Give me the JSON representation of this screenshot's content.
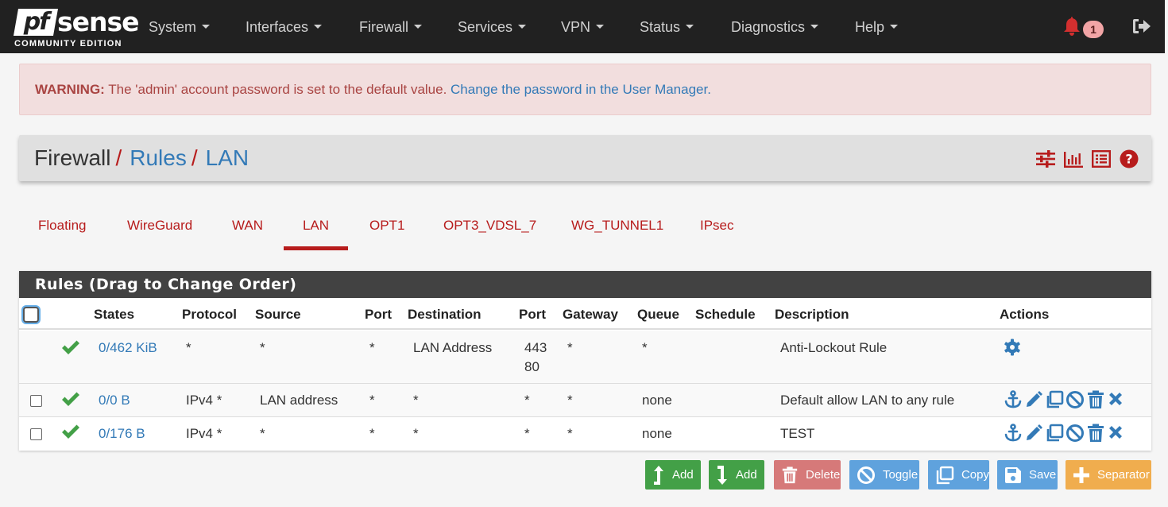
{
  "navbar": {
    "logo_pf": "pf",
    "logo_sense": "sense",
    "logo_edition": "COMMUNITY EDITION",
    "menu": [
      {
        "label": "System"
      },
      {
        "label": "Interfaces"
      },
      {
        "label": "Firewall"
      },
      {
        "label": "Services"
      },
      {
        "label": "VPN"
      },
      {
        "label": "Status"
      },
      {
        "label": "Diagnostics"
      },
      {
        "label": "Help"
      }
    ],
    "notification_count": "1",
    "icons": {
      "notifications": "bell-icon",
      "logout": "sign-out-icon"
    }
  },
  "alert": {
    "prefix": "WARNING:",
    "message": " The 'admin' account password is set to the default value. ",
    "link": "Change the password in the User Manager."
  },
  "breadcrumb": {
    "items": [
      "Firewall",
      "Rules",
      "LAN"
    ],
    "separator": "/",
    "icons": [
      "sliders-icon",
      "bar-chart-icon",
      "list-icon",
      "help-icon"
    ]
  },
  "tabs": [
    {
      "label": "Floating"
    },
    {
      "label": "WireGuard"
    },
    {
      "label": "WAN"
    },
    {
      "label": "LAN",
      "active": true
    },
    {
      "label": "OPT1"
    },
    {
      "label": "OPT3_VDSL_7"
    },
    {
      "label": "WG_TUNNEL1"
    },
    {
      "label": "IPsec"
    }
  ],
  "rules": {
    "title": "Rules (Drag to Change Order)",
    "columns": [
      "States",
      "Protocol",
      "Source",
      "Port",
      "Destination",
      "Port",
      "Gateway",
      "Queue",
      "Schedule",
      "Description",
      "Actions"
    ],
    "rows": [
      {
        "states": "0/462 KiB",
        "protocol": "*",
        "source": "*",
        "src_port": "*",
        "destination": "LAN Address",
        "dst_port_1": "443",
        "dst_port_2": "80",
        "gateway": "*",
        "queue": "*",
        "schedule": "",
        "description": "Anti-Lockout Rule",
        "status": "pass",
        "actions": [
          "gear-icon"
        ]
      },
      {
        "states": "0/0 B",
        "protocol": "IPv4 *",
        "source": "LAN address",
        "src_port": "*",
        "destination": "*",
        "dst_port_1": "*",
        "gateway": "*",
        "queue": "none",
        "schedule": "",
        "description": "Default allow LAN to any rule",
        "status": "pass",
        "actions": [
          "anchor-icon",
          "pencil-icon",
          "copy-icon",
          "disable-icon",
          "trash-icon",
          "times-icon"
        ]
      },
      {
        "states": "0/176 B",
        "protocol": "IPv4 *",
        "source": "*",
        "src_port": "*",
        "destination": "*",
        "dst_port_1": "*",
        "gateway": "*",
        "queue": "none",
        "schedule": "",
        "description": "TEST",
        "status": "pass",
        "actions": [
          "anchor-icon",
          "pencil-icon",
          "copy-icon",
          "disable-icon",
          "trash-icon",
          "times-icon"
        ]
      }
    ]
  },
  "buttons": {
    "add_top": "Add",
    "add_bottom": "Add",
    "delete": "Delete",
    "toggle": "Toggle",
    "copy": "Copy",
    "save": "Save",
    "separator": "Separator"
  },
  "colors": {
    "navbar_bg": "#212121",
    "accent_red": "#b71c1c",
    "link_blue": "#337ab7",
    "success_green": "#43a047",
    "alert_bg": "#f2dede",
    "panel_head": "#424242",
    "warning_orange": "#f0ad4e"
  }
}
